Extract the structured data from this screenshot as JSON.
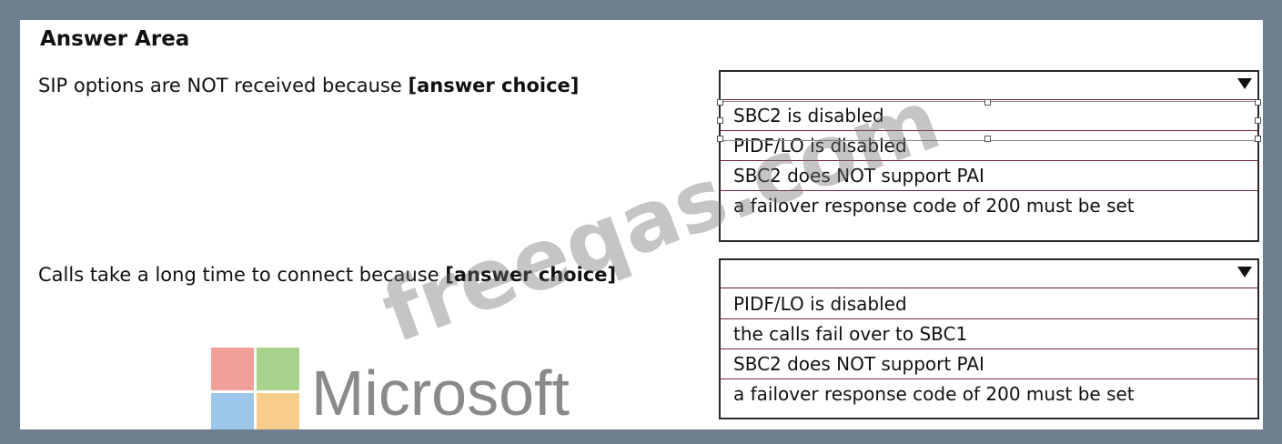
{
  "title": "Answer Area",
  "questions": [
    {
      "text_before": "SIP options are NOT received because ",
      "bold": "[answer choice]",
      "options": [
        "SBC2 is disabled",
        "PIDF/LO is disabled",
        "SBC2 does NOT support PAI",
        "a failover response code of 200 must be set"
      ]
    },
    {
      "text_before": "Calls take a long time to connect because ",
      "bold": "[answer choice]",
      "options": [
        "PIDF/LO is disabled",
        "the calls fail over to SBC1",
        "SBC2 does NOT support PAI",
        "a failover response code of 200 must be set"
      ]
    }
  ],
  "watermark": "freeqas.com",
  "logo": {
    "text": "Microsoft"
  },
  "colors": {
    "frame": "#6f7f8f",
    "option_border": "#7b2a35"
  }
}
